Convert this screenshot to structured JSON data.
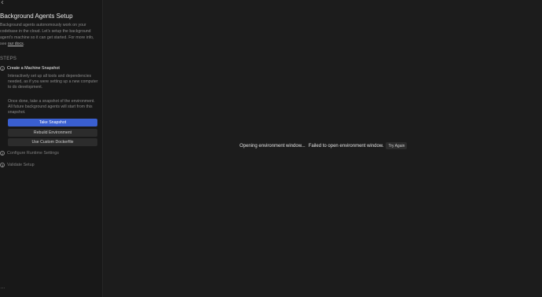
{
  "sidebar": {
    "back_icon": "chevron-left-icon",
    "title": "Background Agents Setup",
    "description_pre": "Background agents autonomously work on your codebase in the cloud. Let's setup the background agent's machine so it can get started. For more info, see ",
    "docs_link": "our docs",
    "description_post": ".",
    "steps_heading": "STEPS",
    "steps": [
      {
        "number": "1",
        "label": "Create a Machine Snapshot",
        "text1": "Interactively set up all tools and dependencies needed, as if you were setting up a new computer to do development.",
        "text2": "Once done, take a snapshot of the environment. All future background agents will start from this snapshot."
      },
      {
        "number": "2",
        "label": "Configure Runtime Settings"
      },
      {
        "number": "3",
        "label": "Validate Setup"
      }
    ],
    "buttons": {
      "take_snapshot": "Take Snapshot",
      "rebuild_environment": "Rebuild Environment",
      "use_custom_dockerfile": "Use Custom Dockerfile"
    },
    "bottom_icon": "ellipsis-icon",
    "bottom_glyph": "…"
  },
  "main": {
    "status_opening": "Opening environment window...",
    "status_failed": "Failed to open environment window.",
    "try_again": "Try Again"
  },
  "colors": {
    "primary_button": "#3a5fd0",
    "background": "#1c1c1c",
    "sidebar_background": "#181818"
  }
}
